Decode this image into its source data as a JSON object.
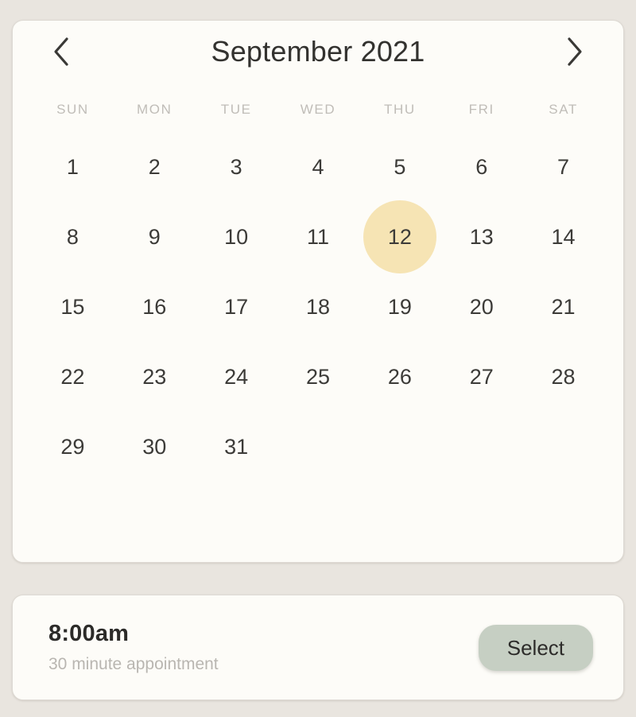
{
  "theme": {
    "page_background": "#e9e5df",
    "card_background": "#fdfcf8",
    "card_border": "#ddd9d3",
    "selected_day_highlight": "#f6e4b4",
    "select_button_background": "#c6cfc3",
    "day_text": "#3c3b38",
    "weekday_text": "#c0bdb8",
    "muted_text": "#b9b6b1"
  },
  "calendar": {
    "month_title": "September 2021",
    "prev_icon": "chevron-left-icon",
    "next_icon": "chevron-right-icon",
    "weekdays": [
      "SUN",
      "MON",
      "TUE",
      "WED",
      "THU",
      "FRI",
      "SAT"
    ],
    "selected_day": "12",
    "days": [
      "1",
      "2",
      "3",
      "4",
      "5",
      "6",
      "7",
      "8",
      "9",
      "10",
      "11",
      "12",
      "13",
      "14",
      "15",
      "16",
      "17",
      "18",
      "19",
      "20",
      "21",
      "22",
      "23",
      "24",
      "25",
      "26",
      "27",
      "28",
      "29",
      "30",
      "31"
    ]
  },
  "appointment": {
    "time": "8:00am",
    "description": "30 minute appointment",
    "select_label": "Select"
  }
}
